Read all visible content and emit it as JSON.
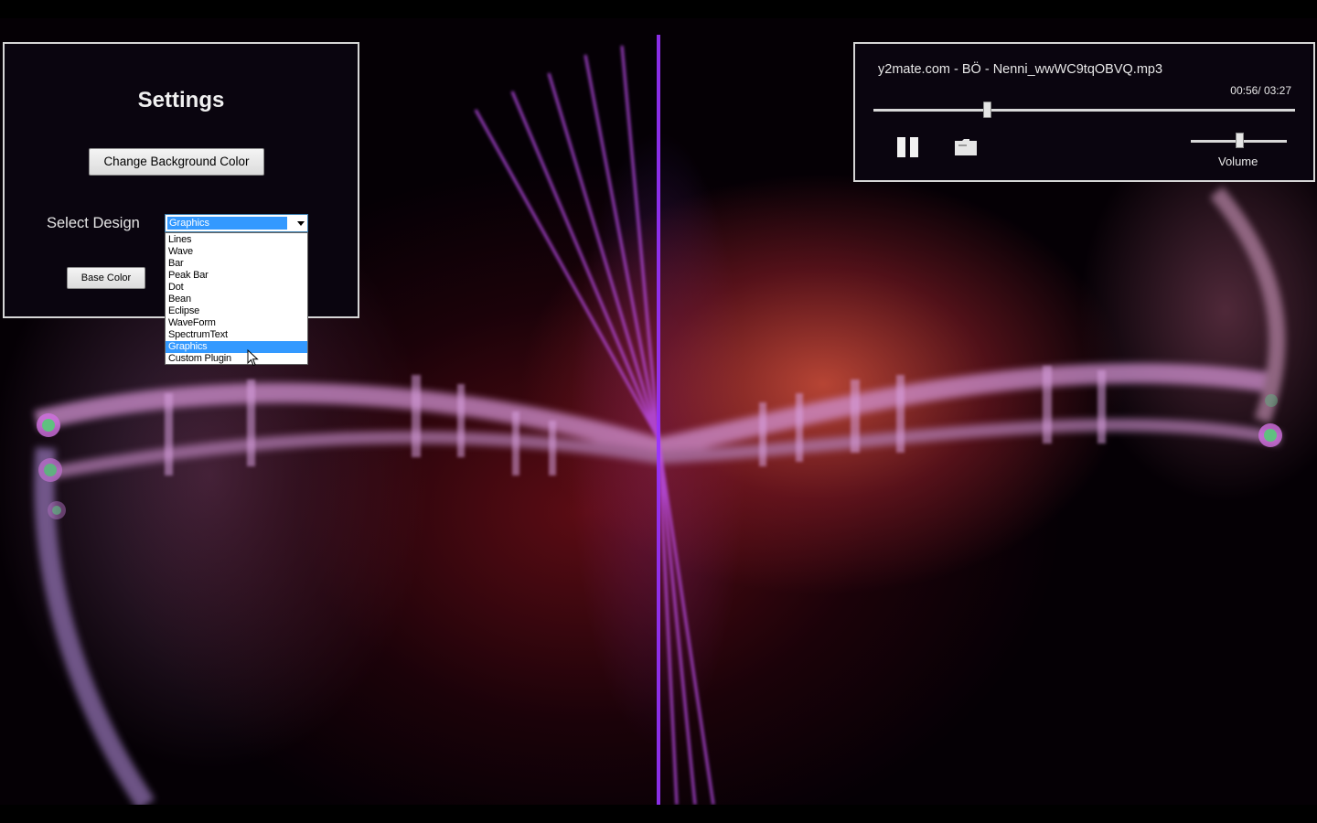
{
  "settings": {
    "title": "Settings",
    "change_background_label": "Change Background Color",
    "select_design_label": "Select Design",
    "selected_design": "Graphics",
    "design_options": [
      "Lines",
      "Wave",
      "Bar",
      "Peak Bar",
      "Dot",
      "Bean",
      "Eclipse",
      "WaveForm",
      "SpectrumText",
      "Graphics",
      "Custom Plugin"
    ],
    "base_color_label": "Base Color"
  },
  "player": {
    "track_title": "y2mate.com - BÖ - Nenni_wwWC9tqOBVQ.mp3",
    "time_display": "00:56/ 03:27",
    "position_fraction": 0.27,
    "volume_fraction": 0.5,
    "volume_label": "Volume",
    "pause_icon": "pause-icon",
    "open_icon": "folder-icon"
  },
  "visualizer": {
    "accent_color": "#c060e0",
    "dot_color": "#60c080",
    "center_line_color": "#9933ff"
  }
}
